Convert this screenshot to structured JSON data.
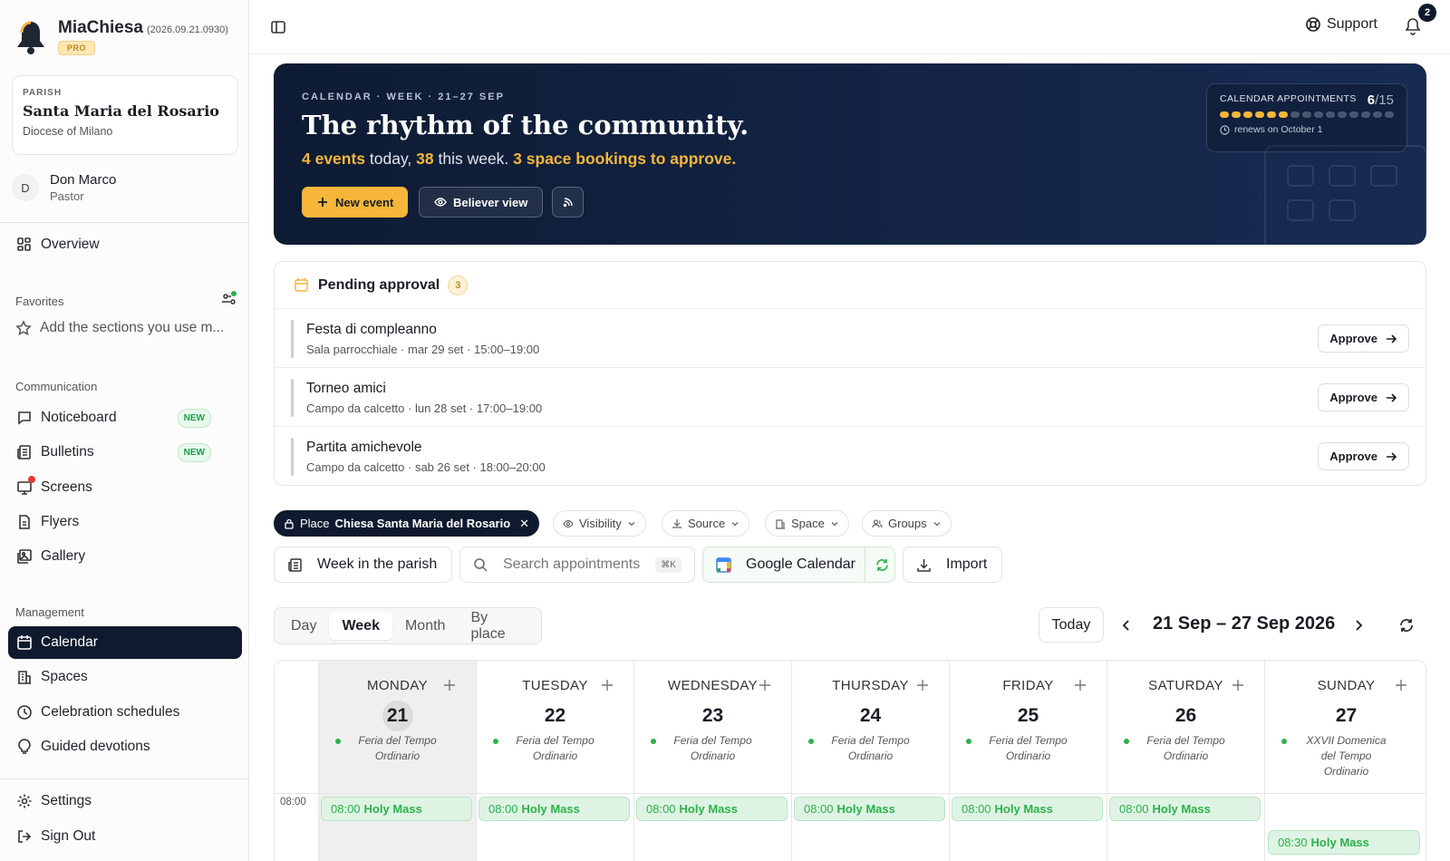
{
  "app": {
    "name": "MiaChiesa",
    "version": "(2026.09.21.0930)",
    "plan": "PRO"
  },
  "parish": {
    "label": "PARISH",
    "name": "Santa Maria del Rosario",
    "diocese": "Diocese of Milano"
  },
  "user": {
    "initial": "D",
    "name": "Don Marco",
    "role": "Pastor"
  },
  "sidebar": {
    "overview": "Overview",
    "favorites_label": "Favorites",
    "favorites_hint": "Add the sections you use m...",
    "communication_label": "Communication",
    "communication": [
      {
        "label": "Noticeboard",
        "badge": "NEW",
        "icon": "message-icon"
      },
      {
        "label": "Bulletins",
        "badge": "NEW",
        "icon": "newspaper-icon"
      },
      {
        "label": "Screens",
        "badge": "",
        "icon": "screen-icon"
      },
      {
        "label": "Flyers",
        "badge": "",
        "icon": "file-icon"
      },
      {
        "label": "Gallery",
        "badge": "",
        "icon": "image-icon"
      }
    ],
    "management_label": "Management",
    "management": [
      {
        "label": "Calendar",
        "icon": "calendar-icon"
      },
      {
        "label": "Spaces",
        "icon": "building-icon"
      },
      {
        "label": "Celebration schedules",
        "icon": "clock-icon"
      },
      {
        "label": "Guided devotions",
        "icon": "bulb-icon"
      }
    ],
    "settings": "Settings",
    "signout": "Sign Out"
  },
  "topbar": {
    "support": "Support",
    "notifications": "2"
  },
  "hero": {
    "kicker": "CALENDAR · WEEK · 21–27 SEP",
    "title": "The rhythm of the community.",
    "sub_today_count": "4 events",
    "sub_today": " today, ",
    "sub_week_count": "38",
    "sub_week": " this week. ",
    "sub_approve": "3 space bookings to approve.",
    "new_event": "New event",
    "believer_view": "Believer view",
    "quota_label": "CALENDAR APPOINTMENTS",
    "quota_used": "6",
    "quota_total": "/15",
    "quota_renew": "renews on October 1"
  },
  "pending": {
    "title": "Pending approval",
    "count": "3",
    "approve_label": "Approve",
    "items": [
      {
        "title": "Festa di compleanno",
        "meta": "Sala parrocchiale · mar 29 set · 15:00–19:00"
      },
      {
        "title": "Torneo amici",
        "meta": "Campo da calcetto · lun 28 set · 17:00–19:00"
      },
      {
        "title": "Partita amichevole",
        "meta": "Campo da calcetto · sab 26 set · 18:00–20:00"
      }
    ]
  },
  "filters": {
    "place_label": "Place",
    "place_value": "Chiesa Santa Maria del Rosario",
    "visibility": "Visibility",
    "source": "Source",
    "space": "Space",
    "groups": "Groups"
  },
  "toolbar": {
    "week_in_parish": "Week in the parish",
    "search_placeholder": "Search appointments",
    "search_kbd": "⌘K",
    "gcal": "Google Calendar",
    "import": "Import"
  },
  "calendar": {
    "views": [
      "Day",
      "Week",
      "Month",
      "By place"
    ],
    "active_view": "Week",
    "today": "Today",
    "range": "21 Sep – 27 Sep 2026",
    "days": [
      {
        "name": "MONDAY",
        "num": "21",
        "lit1": "Feria del Tempo",
        "lit2": "Ordinario",
        "lit3": ""
      },
      {
        "name": "TUESDAY",
        "num": "22",
        "lit1": "Feria del Tempo",
        "lit2": "Ordinario",
        "lit3": ""
      },
      {
        "name": "WEDNESDAY",
        "num": "23",
        "lit1": "Feria del Tempo",
        "lit2": "Ordinario",
        "lit3": ""
      },
      {
        "name": "THURSDAY",
        "num": "24",
        "lit1": "Feria del Tempo",
        "lit2": "Ordinario",
        "lit3": ""
      },
      {
        "name": "FRIDAY",
        "num": "25",
        "lit1": "Feria del Tempo",
        "lit2": "Ordinario",
        "lit3": ""
      },
      {
        "name": "SATURDAY",
        "num": "26",
        "lit1": "Feria del Tempo",
        "lit2": "Ordinario",
        "lit3": ""
      },
      {
        "name": "SUNDAY",
        "num": "27",
        "lit1": "XXVII Domenica",
        "lit2": "del Tempo",
        "lit3": "Ordinario"
      }
    ],
    "time_label": "08:00",
    "events": [
      {
        "time": "08:00",
        "title": "Holy Mass"
      },
      {
        "time": "08:00",
        "title": "Holy Mass"
      },
      {
        "time": "08:00",
        "title": "Holy Mass"
      },
      {
        "time": "08:00",
        "title": "Holy Mass"
      },
      {
        "time": "08:00",
        "title": "Holy Mass"
      },
      {
        "time": "08:00",
        "title": "Holy Mass"
      },
      {
        "time": "08:30",
        "title": "Holy Mass"
      }
    ]
  },
  "colors": {
    "navy": "#0f1a2e",
    "gold": "#f5b63a",
    "green": "#2bb24c"
  }
}
